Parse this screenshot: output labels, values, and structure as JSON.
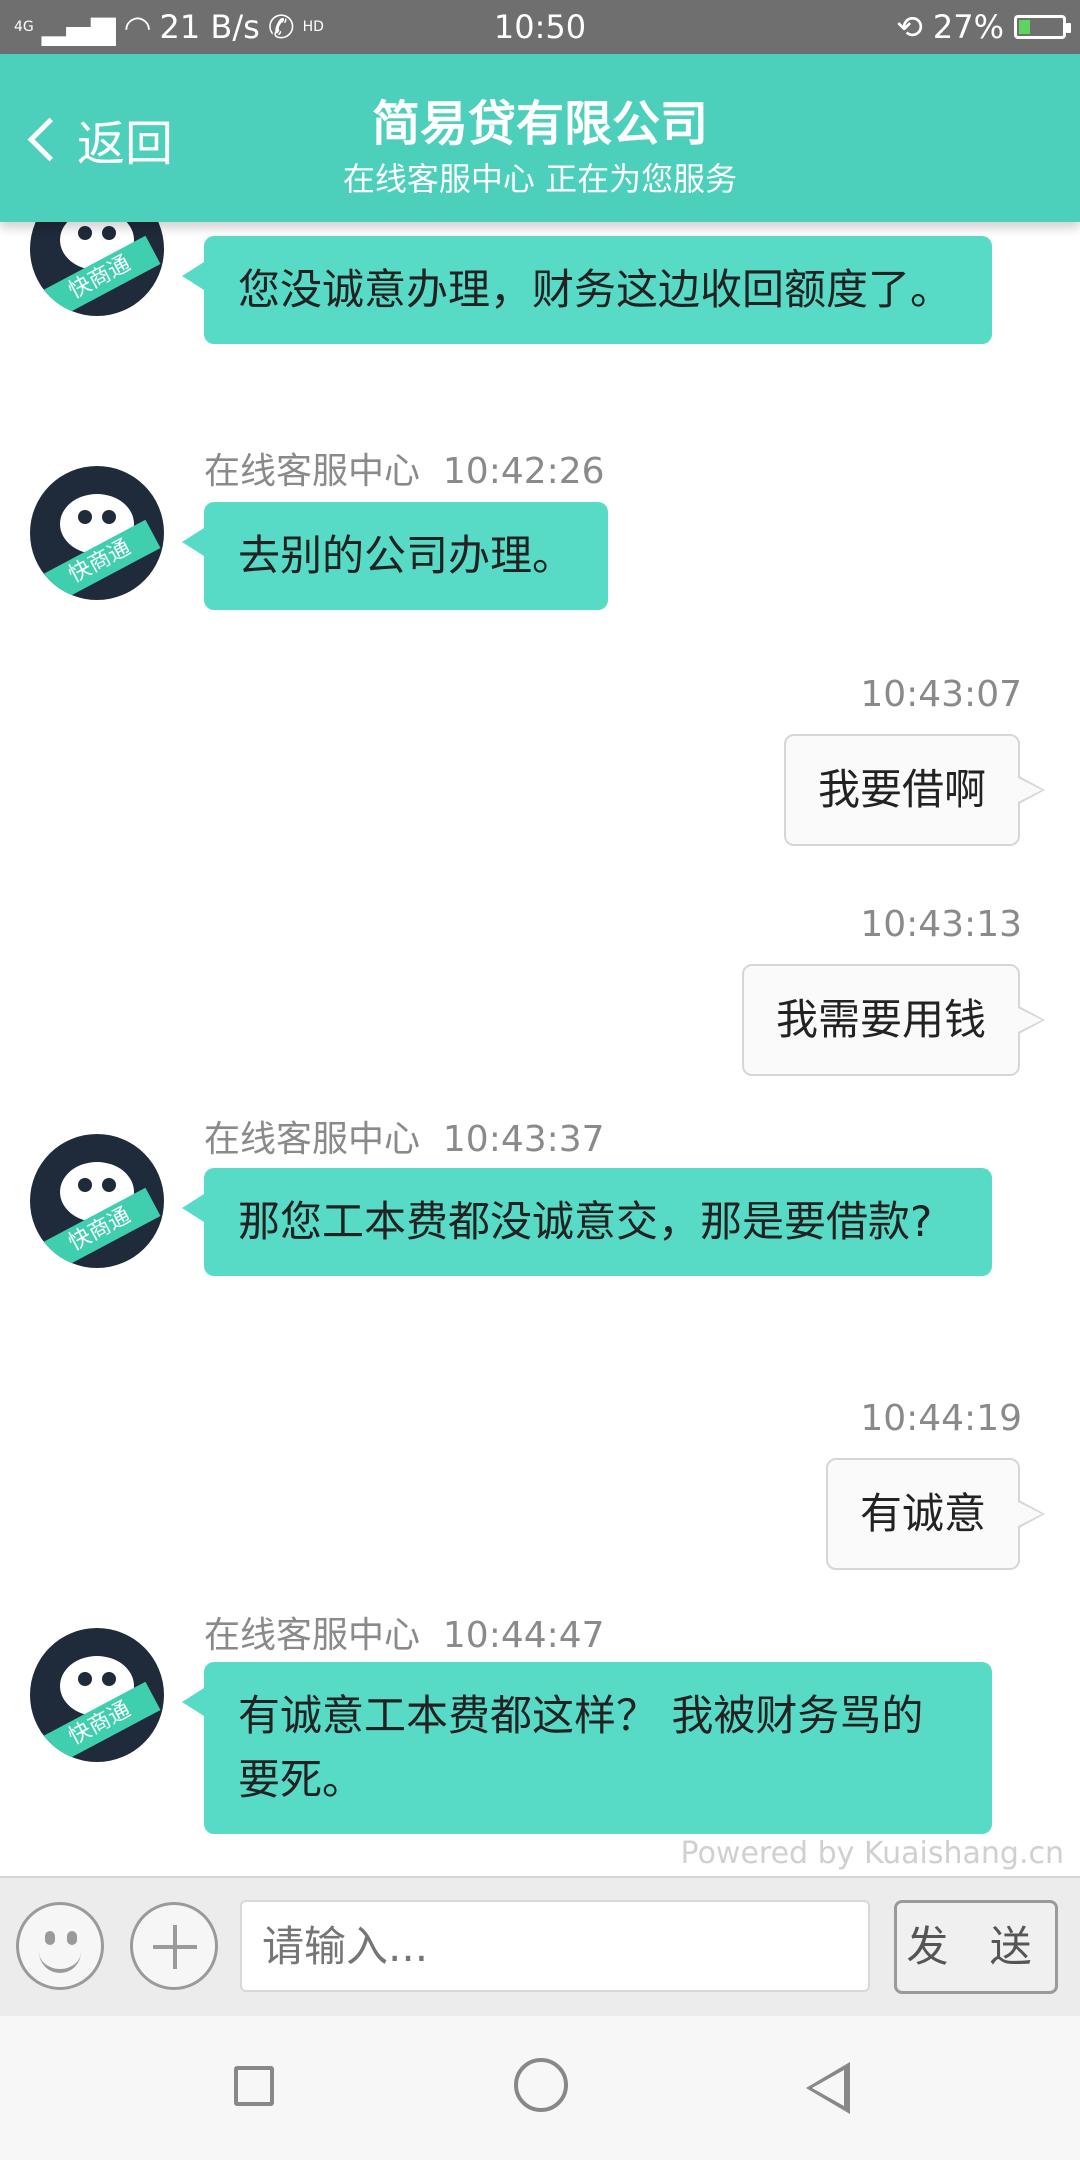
{
  "status_bar": {
    "network": "4G",
    "speed": "21 B/s",
    "call_badge": "HD",
    "time": "10:50",
    "battery": "27%",
    "battery_level": 0.27
  },
  "header": {
    "back_label": "返回",
    "title": "简易贷有限公司",
    "subtitle": "在线客服中心 正在为您服务"
  },
  "avatar_badge": "快商通",
  "messages": [
    {
      "direction": "in",
      "sender": "",
      "time": "",
      "text": "您没诚意办理，财务这边收回额度了。"
    },
    {
      "direction": "in",
      "sender": "在线客服中心",
      "time": "10:42:26",
      "text": "去别的公司办理。"
    },
    {
      "direction": "out",
      "time": "10:43:07",
      "text": "我要借啊"
    },
    {
      "direction": "out",
      "time": "10:43:13",
      "text": "我需要用钱"
    },
    {
      "direction": "in",
      "sender": "在线客服中心",
      "time": "10:43:37",
      "text": "那您工本费都没诚意交，那是要借款?"
    },
    {
      "direction": "out",
      "time": "10:44:19",
      "text": "有诚意"
    },
    {
      "direction": "in",
      "sender": "在线客服中心",
      "time": "10:44:47",
      "text": "有诚意工本费都这样？ 我被财务骂的要死。"
    }
  ],
  "powered_by": "Powered by Kuaishang.cn",
  "input": {
    "placeholder": "请输入...",
    "send_label": "发 送"
  },
  "colors": {
    "header": "#4ccfbb",
    "incoming_bubble": "#58dbc6",
    "outgoing_bubble": "#fafafa"
  }
}
